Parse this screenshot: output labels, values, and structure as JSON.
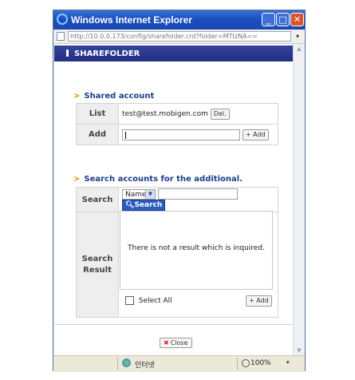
{
  "window": {
    "title": "Windows Internet Explorer",
    "url": "http://10.0.0.173/config/sharefolder.crd?folder=MTIzNA==",
    "min": "_",
    "max": "□",
    "close": "✕"
  },
  "page": {
    "header": "SHAREFOLDER",
    "shared_account": {
      "title": "Shared account",
      "list_label": "List",
      "list_value": "test@test.mobigen.com",
      "del_label": "Del.",
      "add_label": "Add",
      "add_button": "+ Add"
    },
    "search_section": {
      "title": "Search accounts for the additional.",
      "search_label": "Search",
      "select_value": "Name",
      "search_button": "Search",
      "result_label_1": "Search",
      "result_label_2": "Result",
      "empty_message": "There is not a result which is inquired.",
      "select_all": "Select All",
      "add_button": "+ Add"
    },
    "close_button": "Close"
  },
  "status": {
    "zone": "인터넷",
    "zoom": "100%",
    "zoom_dropdown": "▾"
  },
  "scroll": {
    "up": "▲",
    "down": "▼"
  }
}
